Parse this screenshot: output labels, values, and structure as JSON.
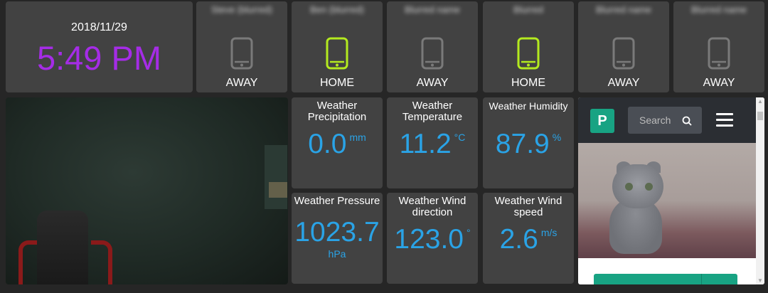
{
  "clock": {
    "date": "2018/11/29",
    "time": "5:49 PM",
    "time_color": "#a52ce6"
  },
  "presence": [
    {
      "name": "Steve (blurred)",
      "state": "AWAY",
      "icon": "phone-icon",
      "color": "#7a7a7a"
    },
    {
      "name": "Ben (blurred)",
      "state": "HOME",
      "icon": "phone-icon",
      "color": "#b4ea1f"
    },
    {
      "name": "Blurred name",
      "state": "AWAY",
      "icon": "phone-icon",
      "color": "#7a7a7a"
    },
    {
      "name": "Blurred",
      "state": "HOME",
      "icon": "phone-icon",
      "color": "#b4ea1f"
    },
    {
      "name": "Blurred name",
      "state": "AWAY",
      "icon": "phone-icon",
      "color": "#7a7a7a"
    },
    {
      "name": "Blurred name",
      "state": "AWAY",
      "icon": "phone-icon",
      "color": "#7a7a7a"
    }
  ],
  "weather": {
    "precipitation": {
      "title": "Weather Precipitation",
      "value": "0.0",
      "unit": "mm"
    },
    "temperature": {
      "title": "Weather Temperature",
      "value": "11.2",
      "unit": "°C"
    },
    "humidity": {
      "title": "Weather Humidity",
      "value": "87.9",
      "unit": "%"
    },
    "pressure": {
      "title": "Weather Pressure",
      "value": "1023.7",
      "unit": "hPa"
    },
    "wind_direction": {
      "title": "Weather Wind direction",
      "value": "123.0",
      "unit": "°"
    },
    "wind_speed": {
      "title": "Weather Wind speed",
      "value": "2.6",
      "unit": "m/s"
    },
    "value_color": "#2aa3e6"
  },
  "web": {
    "logo_letter": "P",
    "search_placeholder": "Search",
    "accent": "#18a383"
  },
  "colors": {
    "background": "#262626",
    "tile": "#424242"
  }
}
